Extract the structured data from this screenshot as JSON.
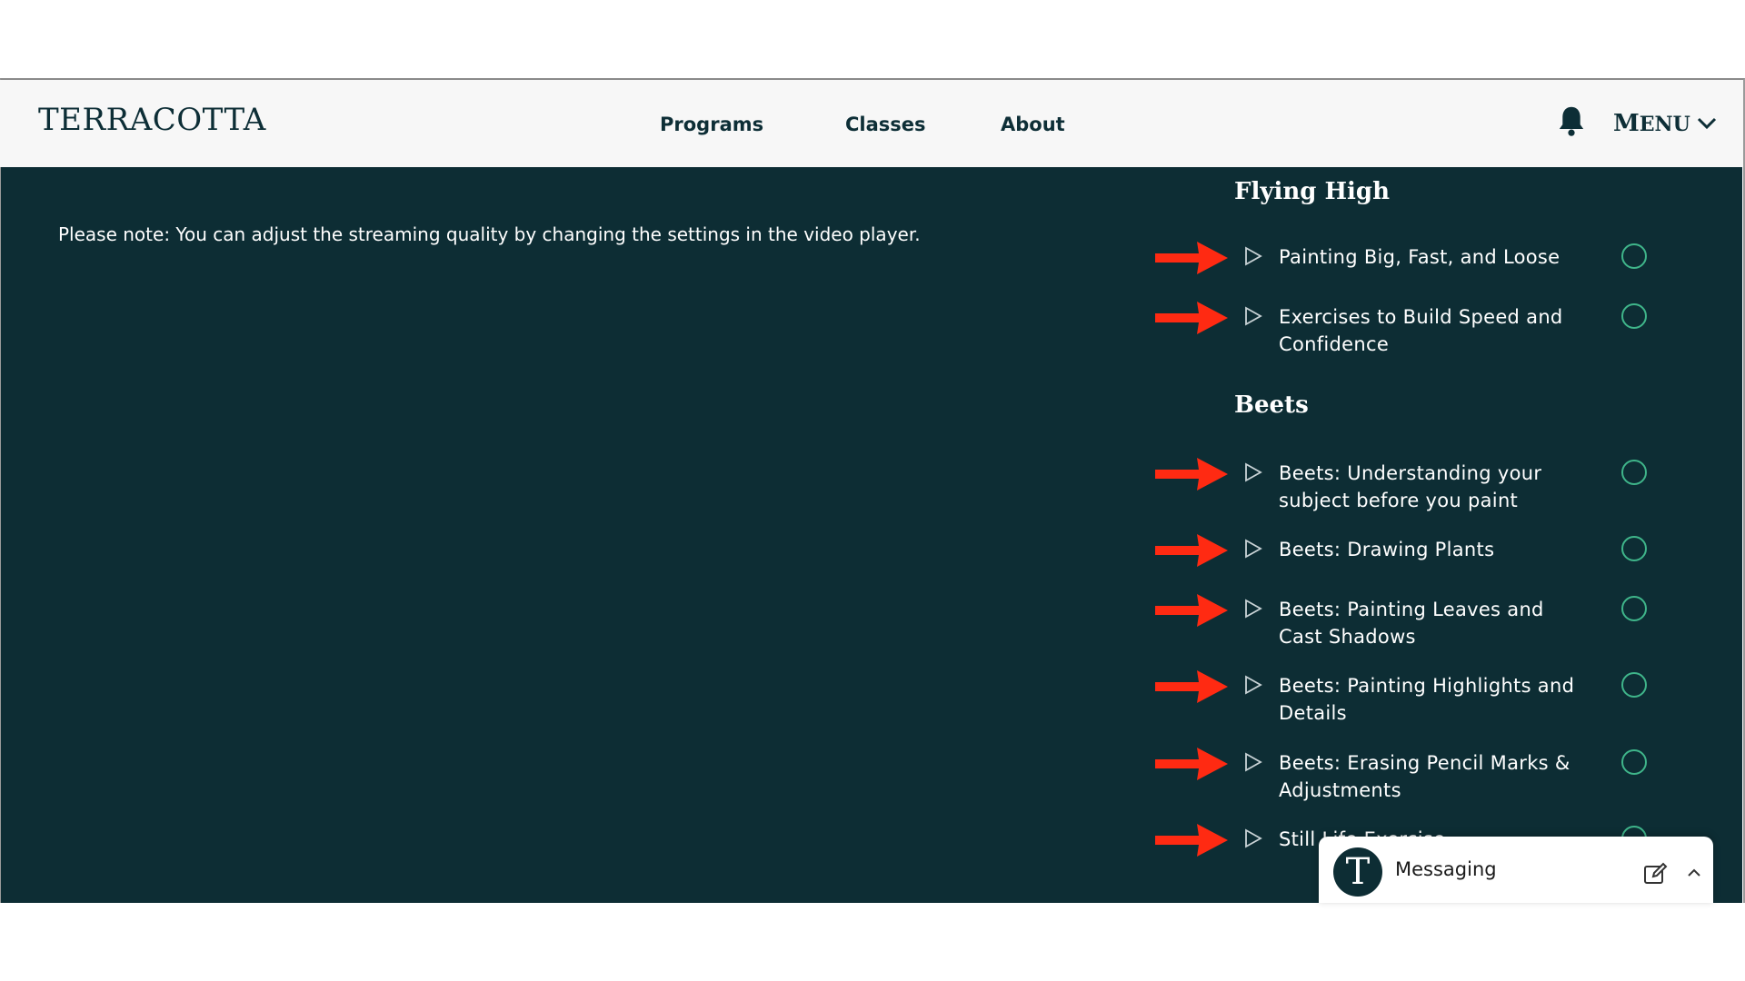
{
  "header": {
    "logo": "TERRACOTTA",
    "nav": [
      "Programs",
      "Classes",
      "About"
    ],
    "menu_cap": "M",
    "menu_rest": "ENU",
    "bell_icon": "bell-icon",
    "menu_icon": "chevron-down-icon"
  },
  "main": {
    "note": "Please note: You can adjust the streaming quality by changing the settings in the video player."
  },
  "sections": [
    {
      "title": "Flying High",
      "lessons": [
        {
          "lines": [
            "Painting Big, Fast, and Loose"
          ]
        },
        {
          "lines": [
            "Exercises to Build Speed and",
            "Confidence"
          ]
        }
      ]
    },
    {
      "title": "Beets",
      "lessons": [
        {
          "lines": [
            "Beets: Understanding your",
            "subject before you paint"
          ]
        },
        {
          "lines": [
            "Beets: Drawing Plants"
          ]
        },
        {
          "lines": [
            "Beets: Painting Leaves and",
            "Cast Shadows"
          ]
        },
        {
          "lines": [
            "Beets: Painting Highlights and",
            "Details"
          ]
        },
        {
          "lines": [
            "Beets: Erasing Pencil Marks &",
            "Adjustments"
          ]
        },
        {
          "lines": [
            "Still Life Exercise"
          ]
        }
      ]
    }
  ],
  "messaging": {
    "avatar_letter": "T",
    "label": "Messaging",
    "edit_icon": "compose-icon",
    "collapse_icon": "chevron-up-icon"
  },
  "colors": {
    "main_bg": "#0d2d34",
    "header_bg": "#f7f7f7",
    "accent_arrow": "#ff2a12",
    "check_ring": "#3fb58a"
  }
}
